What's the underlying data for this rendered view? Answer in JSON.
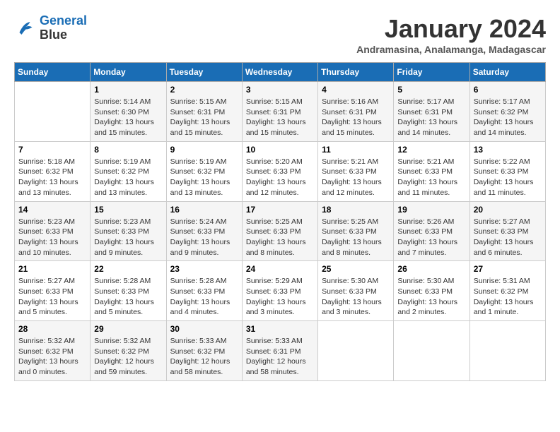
{
  "logo": {
    "line1": "General",
    "line2": "Blue"
  },
  "title": "January 2024",
  "subtitle": "Andramasina, Analamanga, Madagascar",
  "days_header": [
    "Sunday",
    "Monday",
    "Tuesday",
    "Wednesday",
    "Thursday",
    "Friday",
    "Saturday"
  ],
  "weeks": [
    [
      {
        "day": "",
        "info": ""
      },
      {
        "day": "1",
        "info": "Sunrise: 5:14 AM\nSunset: 6:30 PM\nDaylight: 13 hours\nand 15 minutes."
      },
      {
        "day": "2",
        "info": "Sunrise: 5:15 AM\nSunset: 6:31 PM\nDaylight: 13 hours\nand 15 minutes."
      },
      {
        "day": "3",
        "info": "Sunrise: 5:15 AM\nSunset: 6:31 PM\nDaylight: 13 hours\nand 15 minutes."
      },
      {
        "day": "4",
        "info": "Sunrise: 5:16 AM\nSunset: 6:31 PM\nDaylight: 13 hours\nand 15 minutes."
      },
      {
        "day": "5",
        "info": "Sunrise: 5:17 AM\nSunset: 6:31 PM\nDaylight: 13 hours\nand 14 minutes."
      },
      {
        "day": "6",
        "info": "Sunrise: 5:17 AM\nSunset: 6:32 PM\nDaylight: 13 hours\nand 14 minutes."
      }
    ],
    [
      {
        "day": "7",
        "info": "Sunrise: 5:18 AM\nSunset: 6:32 PM\nDaylight: 13 hours\nand 13 minutes."
      },
      {
        "day": "8",
        "info": "Sunrise: 5:19 AM\nSunset: 6:32 PM\nDaylight: 13 hours\nand 13 minutes."
      },
      {
        "day": "9",
        "info": "Sunrise: 5:19 AM\nSunset: 6:32 PM\nDaylight: 13 hours\nand 13 minutes."
      },
      {
        "day": "10",
        "info": "Sunrise: 5:20 AM\nSunset: 6:33 PM\nDaylight: 13 hours\nand 12 minutes."
      },
      {
        "day": "11",
        "info": "Sunrise: 5:21 AM\nSunset: 6:33 PM\nDaylight: 13 hours\nand 12 minutes."
      },
      {
        "day": "12",
        "info": "Sunrise: 5:21 AM\nSunset: 6:33 PM\nDaylight: 13 hours\nand 11 minutes."
      },
      {
        "day": "13",
        "info": "Sunrise: 5:22 AM\nSunset: 6:33 PM\nDaylight: 13 hours\nand 11 minutes."
      }
    ],
    [
      {
        "day": "14",
        "info": "Sunrise: 5:23 AM\nSunset: 6:33 PM\nDaylight: 13 hours\nand 10 minutes."
      },
      {
        "day": "15",
        "info": "Sunrise: 5:23 AM\nSunset: 6:33 PM\nDaylight: 13 hours\nand 9 minutes."
      },
      {
        "day": "16",
        "info": "Sunrise: 5:24 AM\nSunset: 6:33 PM\nDaylight: 13 hours\nand 9 minutes."
      },
      {
        "day": "17",
        "info": "Sunrise: 5:25 AM\nSunset: 6:33 PM\nDaylight: 13 hours\nand 8 minutes."
      },
      {
        "day": "18",
        "info": "Sunrise: 5:25 AM\nSunset: 6:33 PM\nDaylight: 13 hours\nand 8 minutes."
      },
      {
        "day": "19",
        "info": "Sunrise: 5:26 AM\nSunset: 6:33 PM\nDaylight: 13 hours\nand 7 minutes."
      },
      {
        "day": "20",
        "info": "Sunrise: 5:27 AM\nSunset: 6:33 PM\nDaylight: 13 hours\nand 6 minutes."
      }
    ],
    [
      {
        "day": "21",
        "info": "Sunrise: 5:27 AM\nSunset: 6:33 PM\nDaylight: 13 hours\nand 5 minutes."
      },
      {
        "day": "22",
        "info": "Sunrise: 5:28 AM\nSunset: 6:33 PM\nDaylight: 13 hours\nand 5 minutes."
      },
      {
        "day": "23",
        "info": "Sunrise: 5:28 AM\nSunset: 6:33 PM\nDaylight: 13 hours\nand 4 minutes."
      },
      {
        "day": "24",
        "info": "Sunrise: 5:29 AM\nSunset: 6:33 PM\nDaylight: 13 hours\nand 3 minutes."
      },
      {
        "day": "25",
        "info": "Sunrise: 5:30 AM\nSunset: 6:33 PM\nDaylight: 13 hours\nand 3 minutes."
      },
      {
        "day": "26",
        "info": "Sunrise: 5:30 AM\nSunset: 6:33 PM\nDaylight: 13 hours\nand 2 minutes."
      },
      {
        "day": "27",
        "info": "Sunrise: 5:31 AM\nSunset: 6:32 PM\nDaylight: 13 hours\nand 1 minute."
      }
    ],
    [
      {
        "day": "28",
        "info": "Sunrise: 5:32 AM\nSunset: 6:32 PM\nDaylight: 13 hours\nand 0 minutes."
      },
      {
        "day": "29",
        "info": "Sunrise: 5:32 AM\nSunset: 6:32 PM\nDaylight: 12 hours\nand 59 minutes."
      },
      {
        "day": "30",
        "info": "Sunrise: 5:33 AM\nSunset: 6:32 PM\nDaylight: 12 hours\nand 58 minutes."
      },
      {
        "day": "31",
        "info": "Sunrise: 5:33 AM\nSunset: 6:31 PM\nDaylight: 12 hours\nand 58 minutes."
      },
      {
        "day": "",
        "info": ""
      },
      {
        "day": "",
        "info": ""
      },
      {
        "day": "",
        "info": ""
      }
    ]
  ]
}
